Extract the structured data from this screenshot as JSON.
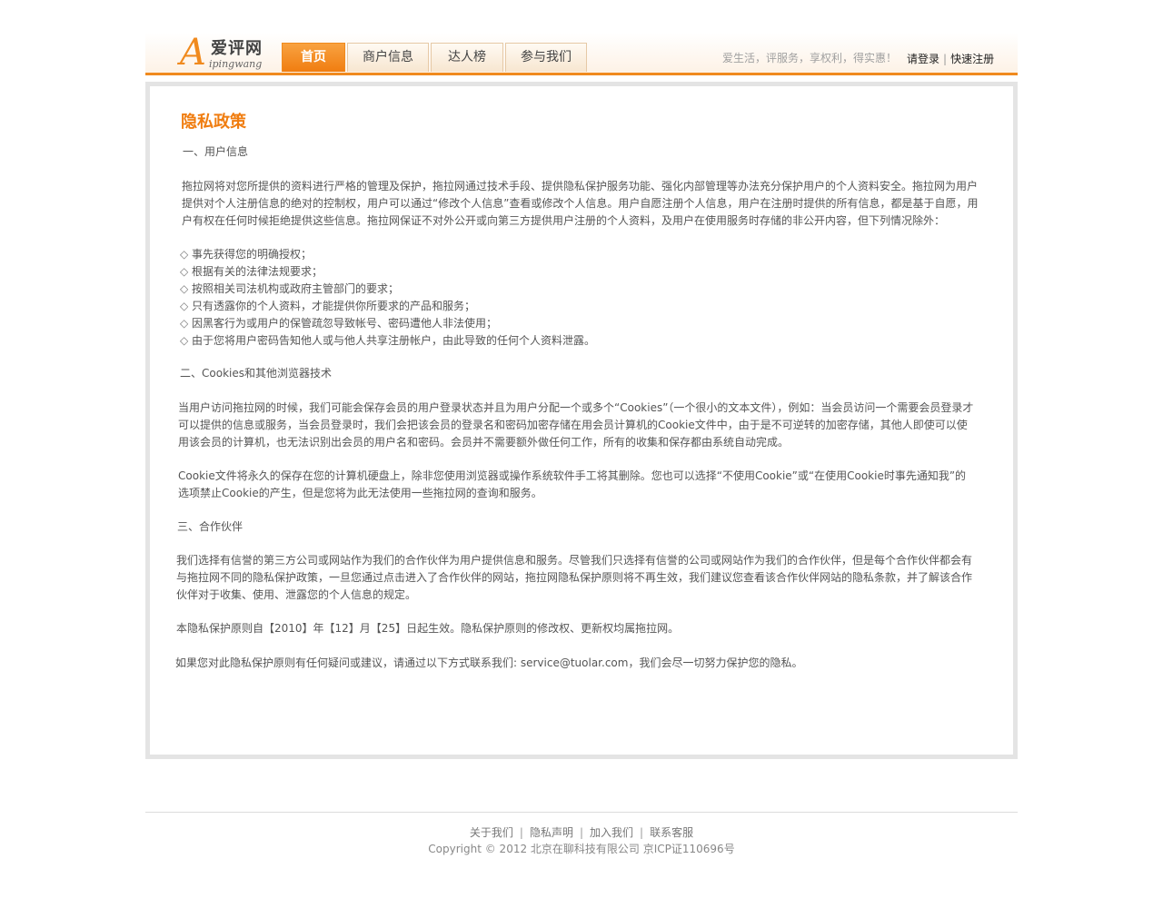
{
  "logo": {
    "letter": "A",
    "cn": "爱评网",
    "pinyin": "ipingwang"
  },
  "nav": [
    {
      "label": "首页",
      "active": true
    },
    {
      "label": "商户信息"
    },
    {
      "label": "达人榜"
    },
    {
      "label": "参与我们"
    }
  ],
  "header": {
    "slogan": "爱生活，评服务，享权利，得实惠！",
    "login": "请登录",
    "separator": "|",
    "register": "快速注册"
  },
  "main": {
    "title": "隐私政策",
    "section1_heading": "一、用户信息",
    "section1_para": "拖拉网将对您所提供的资料进行严格的管理及保护，拖拉网通过技术手段、提供隐私保护服务功能、强化内部管理等办法充分保护用户的个人资料安全。拖拉网为用户提供对个人注册信息的绝对的控制权，用户可以通过“修改个人信息”查看或修改个人信息。用户自愿注册个人信息，用户在注册时提供的所有信息，都是基于自愿，用户有权在任何时候拒绝提供这些信息。拖拉网保证不对外公开或向第三方提供用户注册的个人资料，及用户在使用服务时存储的非公开内容，但下列情况除外：",
    "exceptions": [
      "事先获得您的明确授权；",
      "根据有关的法律法规要求；",
      "按照相关司法机构或政府主管部门的要求；",
      "只有透露你的个人资料，才能提供你所要求的产品和服务；",
      "因黑客行为或用户的保管疏忽导致帐号、密码遭他人非法使用；",
      "由于您将用户密码告知他人或与他人共享注册帐户，由此导致的任何个人资料泄露。"
    ],
    "section2_heading": "二、Cookies和其他浏览器技术",
    "section2_para1": "当用户访问拖拉网的时候，我们可能会保存会员的用户登录状态并且为用户分配一个或多个“Cookies”（一个很小的文本文件），例如：当会员访问一个需要会员登录才可以提供的信息或服务，当会员登录时，我们会把该会员的登录名和密码加密存储在用会员计算机的Cookie文件中，由于是不可逆转的加密存储，其他人即使可以使用该会员的计算机，也无法识别出会员的用户名和密码。会员并不需要额外做任何工作，所有的收集和保存都由系统自动完成。",
    "section2_para2": "Cookie文件将永久的保存在您的计算机硬盘上，除非您使用浏览器或操作系统软件手工将其删除。您也可以选择“不使用Cookie”或“在使用Cookie时事先通知我”的选项禁止Cookie的产生，但是您将为此无法使用一些拖拉网的查询和服务。",
    "section3_heading": "三、合作伙伴",
    "section3_para": "我们选择有信誉的第三方公司或网站作为我们的合作伙伴为用户提供信息和服务。尽管我们只选择有信誉的公司或网站作为我们的合作伙伴，但是每个合作伙伴都会有与拖拉网不同的隐私保护政策，一旦您通过点击进入了合作伙伴的网站，拖拉网隐私保护原则将不再生效，我们建议您查看该合作伙伴网站的隐私条款，并了解该合作伙伴对于收集、使用、泄露您的个人信息的规定。",
    "effective": "本隐私保护原则自【2010】年【12】月【25】日起生效。隐私保护原则的修改权、更新权均属拖拉网。",
    "contact": "如果您对此隐私保护原则有任何疑问或建议，请通过以下方式联系我们: service@tuolar.com，我们会尽一切努力保护您的隐私。"
  },
  "footer": {
    "links": [
      "关于我们",
      "隐私声明",
      "加入我们",
      "联系客服"
    ],
    "bar": "|",
    "copyright": "Copyright © 2012 北京在聊科技有限公司    京ICP证110696号"
  },
  "colors": {
    "accent": "#f08a1e",
    "title": "#f07d10",
    "border": "#e4e4e4"
  }
}
